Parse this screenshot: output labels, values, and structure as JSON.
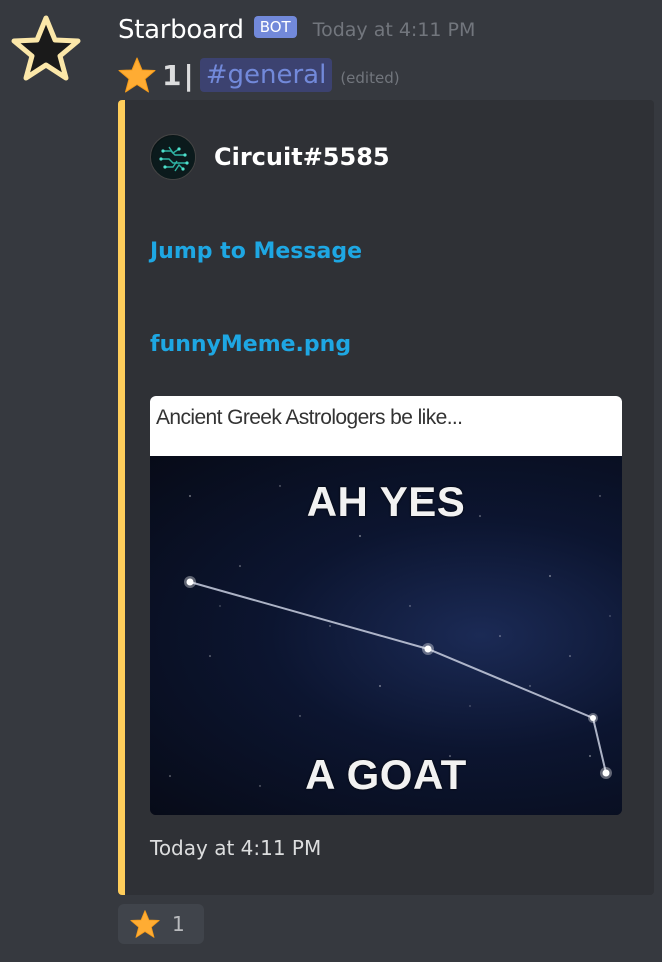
{
  "message": {
    "author": {
      "name": "Starboard",
      "badge": "BOT",
      "avatar_icon": "star-outline-icon"
    },
    "timestamp": "Today at 4:11 PM",
    "content": {
      "emoji_icon": "star-icon",
      "star_count": "1",
      "separator": "|",
      "channel": "#general",
      "edited": "(edited)"
    },
    "embed": {
      "accent_color": "#ffcd5b",
      "author": {
        "name": "Circuit#5585",
        "icon": "circuit-avatar-icon"
      },
      "jump_link": "Jump to Message",
      "attachment_name": "funnyMeme.png",
      "image": {
        "caption": "Ancient Greek Astrologers be like...",
        "top_text": "AH YES",
        "bottom_text": "A GOAT"
      },
      "footer": "Today at 4:11 PM"
    }
  },
  "reactions": [
    {
      "emoji_icon": "star-icon",
      "count": "1"
    }
  ],
  "colors": {
    "background": "#36393f",
    "embed_background": "#2f3136",
    "link": "#1ea7e3",
    "bot_badge": "#7289da"
  }
}
